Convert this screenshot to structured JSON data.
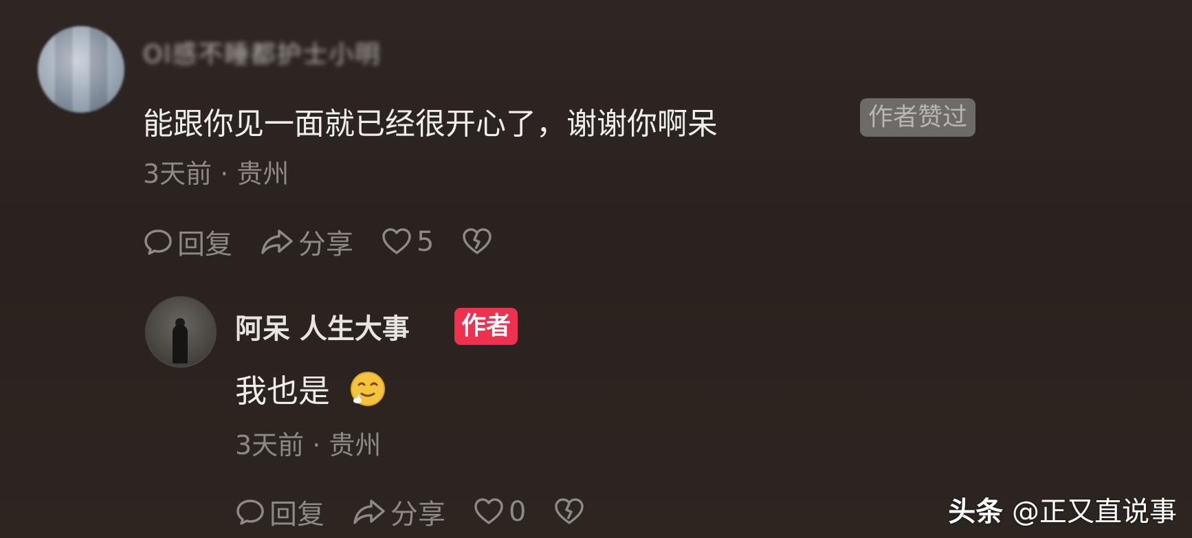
{
  "comment": {
    "username": "Ol感不睡都护士小明",
    "text": "能跟你见一面就已经很开心了，谢谢你啊呆",
    "liked_badge": "作者赞过",
    "meta": "3天前 · 贵州",
    "actions": {
      "reply": "回复",
      "share": "分享",
      "like_count": "5"
    }
  },
  "reply": {
    "author_name": "阿呆 人生大事",
    "author_badge": "作者",
    "text": "我也是",
    "emoji": "drooling-face-emoji",
    "meta": "3天前 · 贵州",
    "actions": {
      "reply": "回复",
      "share": "分享",
      "like_count": "0"
    }
  },
  "watermark": {
    "brand": "头条",
    "handle": "@正又直说事"
  },
  "colors": {
    "background": "#2b231f",
    "author_badge": "#f0304f",
    "muted_text": "#8e8985"
  },
  "icons": [
    "comment-bubble-icon",
    "share-arrow-icon",
    "heart-icon",
    "broken-heart-icon"
  ]
}
